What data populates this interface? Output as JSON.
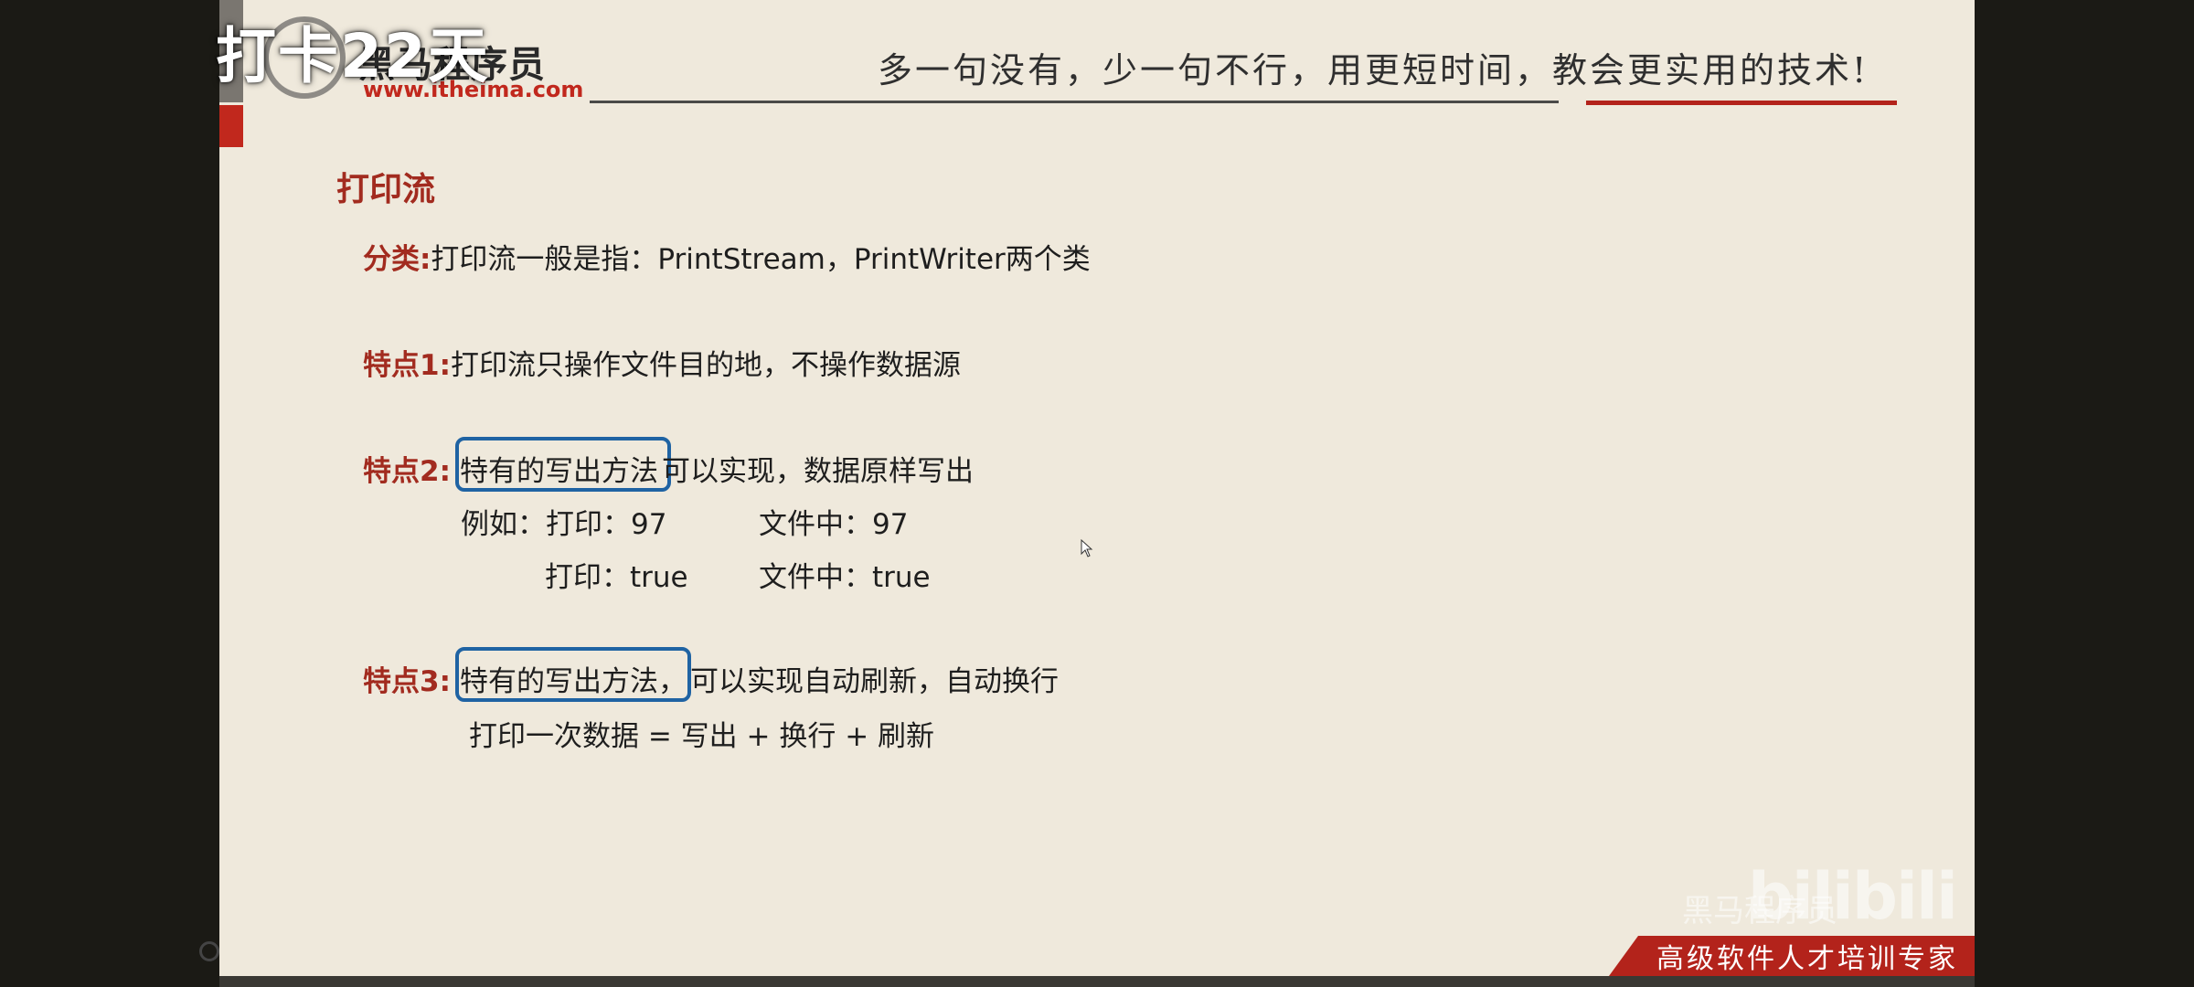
{
  "overlay": {
    "badge": "打卡22天"
  },
  "header": {
    "logo_name": "黑马程序员",
    "logo_url": "www.itheima.com",
    "slogan": "多一句没有，少一句不行，用更短时间，教会更实用的技术!"
  },
  "content": {
    "title": "打印流",
    "category": {
      "key": "分类:",
      "text": "打印流一般是指：PrintStream，PrintWriter两个类"
    },
    "feature1": {
      "key": "特点1:",
      "text": "打印流只操作文件目的地，不操作数据源"
    },
    "feature2": {
      "key": "特点2:",
      "boxed": "特有的写出方法",
      "text": "可以实现，数据原样写出",
      "example_label": "例如：打印：97",
      "example_file1": "文件中：97",
      "example_print2": "打印：true",
      "example_file2": "文件中：true"
    },
    "feature3": {
      "key": "特点3:",
      "boxed": "特有的写出方法，",
      "text": "可以实现自动刷新，自动换行",
      "formula": "打印一次数据 = 写出 + 换行 + 刷新"
    }
  },
  "footer": {
    "tagline": "高级软件人才培训专家",
    "watermark_small": "黑马程序员",
    "watermark_bili": "bilibili"
  },
  "colors": {
    "accent_red": "#a22b1f",
    "box_blue": "#1f63a3",
    "slide_bg": "#efe9dc"
  }
}
